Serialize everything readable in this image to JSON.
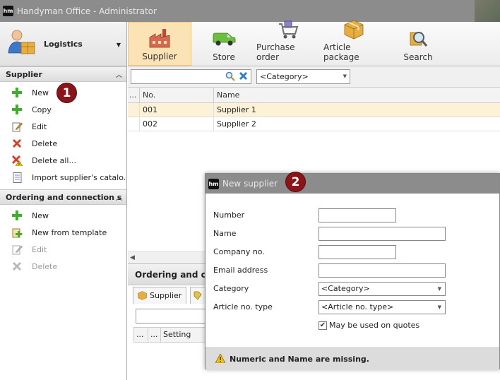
{
  "window": {
    "title": "Handyman Office - Administrator",
    "logo": "hm"
  },
  "module": {
    "label": "Logistics",
    "icon": "person-box-icon"
  },
  "ribbon": {
    "buttons": [
      {
        "label": "Supplier",
        "icon": "factory-icon",
        "active": true
      },
      {
        "label": "Store",
        "icon": "van-icon",
        "active": false
      },
      {
        "label": "Purchase order",
        "icon": "cart-icon",
        "active": false
      },
      {
        "label": "Article package",
        "icon": "package-icon",
        "active": false
      },
      {
        "label": "Search",
        "icon": "magnifier-icon",
        "active": false
      }
    ]
  },
  "sidebar": {
    "supplier_section": {
      "title": "Supplier",
      "items": [
        {
          "label": "New",
          "icon": "plus-icon",
          "disabled": false
        },
        {
          "label": "Copy",
          "icon": "plus-icon",
          "disabled": false
        },
        {
          "label": "Edit",
          "icon": "edit-icon",
          "disabled": false
        },
        {
          "label": "Delete",
          "icon": "delete-icon",
          "disabled": false
        },
        {
          "label": "Delete all...",
          "icon": "delete-warning-icon",
          "disabled": false
        },
        {
          "label": "Import supplier's catalo...",
          "icon": "document-icon",
          "disabled": false
        }
      ]
    },
    "ordering_section": {
      "title": "Ordering and connection s",
      "items": [
        {
          "label": "New",
          "icon": "plus-icon",
          "disabled": false
        },
        {
          "label": "New from template",
          "icon": "template-icon",
          "disabled": false
        },
        {
          "label": "Edit",
          "icon": "edit-icon",
          "disabled": true
        },
        {
          "label": "Delete",
          "icon": "delete-icon",
          "disabled": true
        }
      ]
    }
  },
  "toolbar": {
    "search_value": "",
    "category_value": "<Category>"
  },
  "grid": {
    "columns": [
      "...",
      "No.",
      "Name"
    ],
    "rows": [
      {
        "no": "001",
        "name": "Supplier 1",
        "selected": true
      },
      {
        "no": "002",
        "name": "Supplier 2",
        "selected": false
      }
    ]
  },
  "bottom_panel": {
    "title": "Ordering and conn",
    "tab_label": "Supplier",
    "grid_columns": [
      "...",
      "...",
      "Setting"
    ]
  },
  "dialog": {
    "title": "New supplier",
    "fields": {
      "number_label": "Number",
      "name_label": "Name",
      "company_label": "Company no.",
      "email_label": "Email address",
      "category_label": "Category",
      "category_value": "<Category>",
      "article_type_label": "Article no. type",
      "article_type_value": "<Article no. type>",
      "quotes_label": "May be used on quotes",
      "quotes_checked": true
    },
    "footer_message": "Numeric and Name are missing."
  },
  "annotations": {
    "badge1": "1",
    "badge2": "2"
  }
}
